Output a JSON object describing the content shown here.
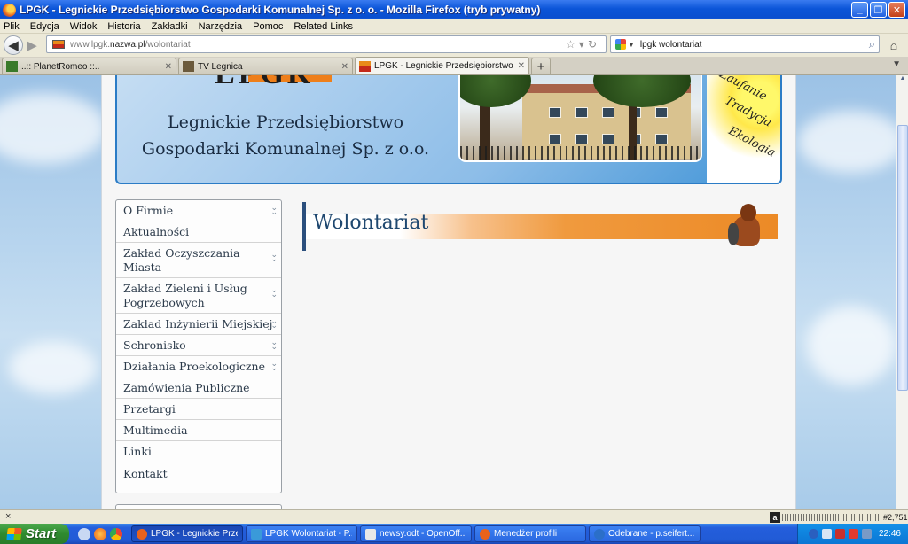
{
  "window": {
    "title": "LPGK - Legnickie Przedsiębiorstwo Gospodarki Komunalnej Sp. z o. o. - Mozilla Firefox (tryb prywatny)"
  },
  "menu": [
    "Plik",
    "Edycja",
    "Widok",
    "Historia",
    "Zakładki",
    "Narzędzia",
    "Pomoc",
    "Related Links"
  ],
  "nav": {
    "url_prefix": "www.lpgk.",
    "url_domain": "nazwa.pl",
    "url_path": "/wolontariat",
    "search_value": "lpgk wolontariat"
  },
  "tabs": [
    {
      "label": "..:: PlanetRomeo ::..",
      "icon": "planetromeo-icon",
      "active": false
    },
    {
      "label": "TV Legnica",
      "icon": "tv-icon",
      "active": false
    },
    {
      "label": "LPGK - Legnickie Przedsiębiorstwo Gospo...",
      "icon": "lpgk-icon",
      "active": true
    }
  ],
  "header": {
    "logo_text": "LPGK",
    "company_line1": "Legnickie Przedsiębiorstwo",
    "company_line2": "Gospodarki Komunalnej Sp. z o.o.",
    "slogan": [
      "Zaufanie",
      "Tradycja",
      "Ekologia"
    ]
  },
  "sidebar": {
    "items": [
      {
        "label": "O Firmie",
        "expandable": true
      },
      {
        "label": "Aktualności",
        "expandable": false
      },
      {
        "label": "Zakład Oczyszczania Miasta",
        "expandable": true
      },
      {
        "label": "Zakład Zieleni i Usług Pogrzebowych",
        "expandable": true
      },
      {
        "label": "Zakład Inżynierii Miejskiej",
        "expandable": true
      },
      {
        "label": "Schronisko",
        "expandable": true
      },
      {
        "label": "Działania Proekologiczne",
        "expandable": true
      },
      {
        "label": "Zamówienia Publiczne",
        "expandable": false
      },
      {
        "label": "Przetargi",
        "expandable": false
      },
      {
        "label": "Multimedia",
        "expandable": false
      },
      {
        "label": "Linki",
        "expandable": false
      },
      {
        "label": "Kontakt",
        "expandable": false
      }
    ]
  },
  "content": {
    "heading": "Wolontariat"
  },
  "statusbar": {
    "close_glyph": "×",
    "addon_value": "#2,751"
  },
  "taskbar": {
    "start_label": "Start",
    "tasks": [
      {
        "label": "LPGK - Legnickie Prze...",
        "active": true,
        "color": "#e9621b"
      },
      {
        "label": "LPGK Wolontariat - P...",
        "active": false,
        "color": "#3a9ad9"
      },
      {
        "label": "newsy.odt - OpenOff...",
        "active": false,
        "color": "#e8e8e8"
      },
      {
        "label": "Menedżer profili",
        "active": false,
        "color": "#e9621b"
      },
      {
        "label": "Odebrane - p.seifert...",
        "active": false,
        "color": "#2b6fc9"
      }
    ],
    "clock": "22:46"
  }
}
